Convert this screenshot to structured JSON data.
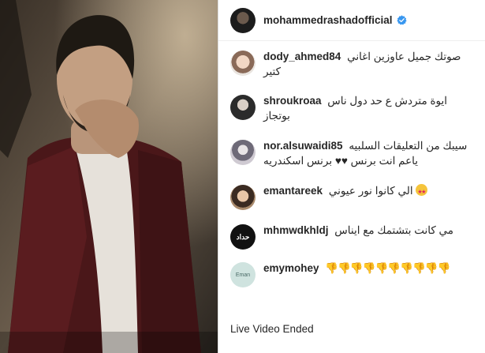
{
  "header": {
    "username": "mohammedrashadofficial"
  },
  "comments": [
    {
      "user": "dody_ahmed84",
      "text": "صوتك جميل عاوزين اغاني كتير"
    },
    {
      "user": "shroukroaa",
      "text": "ايوة متردش ع حد دول ناس بوتجاز"
    },
    {
      "user": "nor.alsuwaidi85",
      "text": "سيبك من التعليقات السلبيه ياعم انت برنس ♥♥ برنس اسكندريه"
    },
    {
      "user": "emantareek",
      "text": "الي كانوا نور عيوني"
    },
    {
      "user": "mhmwdkhldj",
      "text": "مي كانت بتشتمك مع ايناس"
    },
    {
      "user": "emymohey",
      "text": "👎👎👎👎👎👎👎👎👎👎"
    }
  ],
  "avatars": {
    "emymohey_label": "Eman",
    "mhmwdkhldj_label": "حداد"
  },
  "status": {
    "live_ended": "Live Video Ended"
  },
  "colors": {
    "verified": "#3897f0",
    "text": "#262626",
    "border": "#dbdbdb"
  }
}
